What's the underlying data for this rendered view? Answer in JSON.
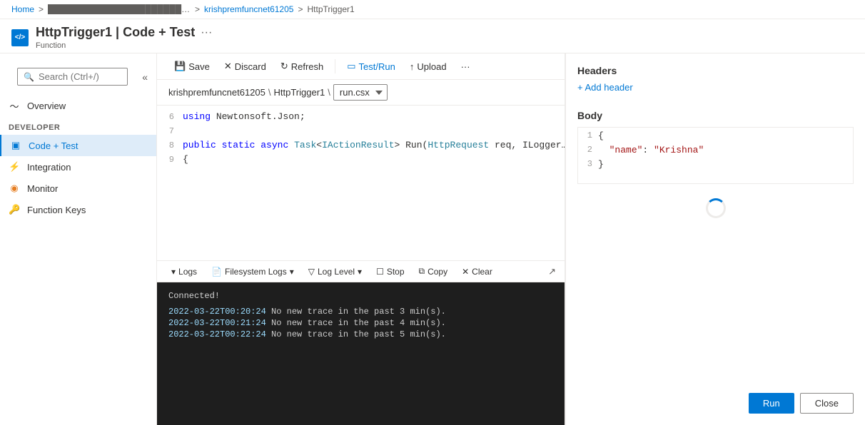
{
  "breadcrumb": {
    "home": "Home",
    "separator": ">",
    "resource": "krishpremfuncnet61205",
    "function": "HttpTrigger1"
  },
  "title": {
    "icon": "</>",
    "name": "HttpTrigger1",
    "separator": "|",
    "subtitle_part": "Code + Test",
    "more": "···",
    "label": "Function"
  },
  "sidebar": {
    "search_placeholder": "Search (Ctrl+/)",
    "collapse_label": "«",
    "section_label": "Developer",
    "items": [
      {
        "id": "overview",
        "label": "Overview",
        "icon": "~"
      },
      {
        "id": "code-test",
        "label": "Code + Test",
        "icon": "▣",
        "active": true
      },
      {
        "id": "integration",
        "label": "Integration",
        "icon": "⚡"
      },
      {
        "id": "monitor",
        "label": "Monitor",
        "icon": "◉"
      },
      {
        "id": "function-keys",
        "label": "Function Keys",
        "icon": "🔑"
      }
    ]
  },
  "toolbar": {
    "save": "Save",
    "discard": "Discard",
    "refresh": "Refresh",
    "test_run": "Test/Run",
    "upload": "Upload",
    "more": "···"
  },
  "code_breadcrumb": {
    "resource": "krishpremfuncnet61205",
    "function": "HttpTrigger1",
    "file": "run.csx"
  },
  "code_lines": [
    {
      "num": "6",
      "content": "using Newtonsoft.Json;"
    },
    {
      "num": "7",
      "content": ""
    },
    {
      "num": "8",
      "content": "public static async Task<IActionResult> Run(HttpRequest req, ILogger"
    },
    {
      "num": "9",
      "content": "{"
    }
  ],
  "logs_toolbar": {
    "logs": "Logs",
    "filesystem_logs": "Filesystem Logs",
    "log_level": "Log Level",
    "stop": "Stop",
    "copy": "Copy",
    "clear": "Clear"
  },
  "terminal": {
    "connected": "Connected!",
    "lines": [
      "2022-03-22T00:20:24  No new trace in the past 3 min(s).",
      "2022-03-22T00:21:24  No new trace in the past 4 min(s).",
      "2022-03-22T00:22:24  No new trace in the past 5 min(s)."
    ]
  },
  "right_panel": {
    "headers_title": "Headers",
    "add_header": "+ Add header",
    "body_title": "Body",
    "body_lines": [
      {
        "num": "1",
        "content": "{"
      },
      {
        "num": "2",
        "content": "  \"name\": \"Krishna\""
      },
      {
        "num": "3",
        "content": "}"
      }
    ],
    "run_btn": "Run",
    "close_btn": "Close"
  }
}
